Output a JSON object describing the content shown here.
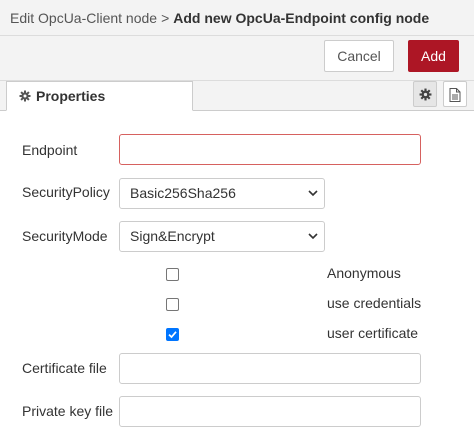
{
  "header": {
    "parent": "Edit OpcUa-Client node",
    "separator": ">",
    "current": "Add new OpcUa-Endpoint config node"
  },
  "buttons": {
    "cancel": "Cancel",
    "add": "Add"
  },
  "tabs": {
    "properties": "Properties",
    "icons": [
      "gear-icon",
      "document-icon"
    ]
  },
  "form": {
    "endpoint": {
      "label": "Endpoint",
      "value": "",
      "placeholder": ""
    },
    "security_policy": {
      "label": "SecurityPolicy",
      "value": "Basic256Sha256"
    },
    "security_mode": {
      "label": "SecurityMode",
      "value": "Sign&Encrypt"
    },
    "options": [
      {
        "label": "Anonymous",
        "checked": false
      },
      {
        "label": "use credentials",
        "checked": false
      },
      {
        "label": "user certificate",
        "checked": true
      }
    ],
    "certificate_file": {
      "label": "Certificate file",
      "value": ""
    },
    "private_key_file": {
      "label": "Private key file",
      "value": ""
    }
  },
  "colors": {
    "accent": "#ad1625",
    "checkbox": "#0075ff",
    "error_border": "#d6615f"
  }
}
